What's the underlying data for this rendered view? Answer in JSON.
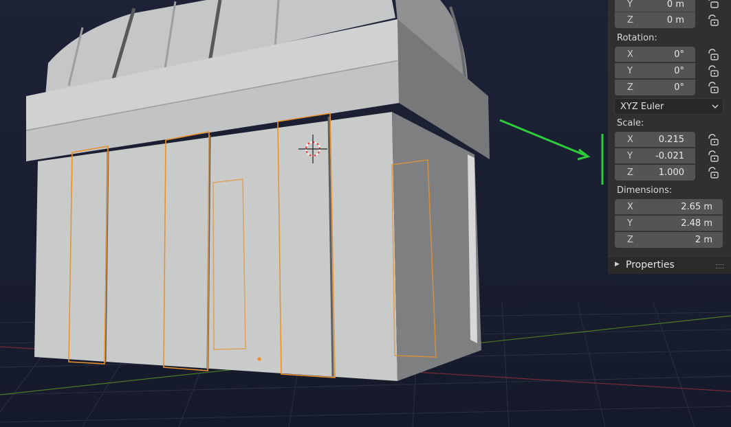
{
  "panel": {
    "location": {
      "y": {
        "axis": "Y",
        "value": "0 m"
      },
      "z": {
        "axis": "Z",
        "value": "0 m"
      }
    },
    "rotation": {
      "label": "Rotation:",
      "x": {
        "axis": "X",
        "value": "0°"
      },
      "y": {
        "axis": "Y",
        "value": "0°"
      },
      "z": {
        "axis": "Z",
        "value": "0°"
      }
    },
    "rotation_mode": "XYZ Euler",
    "scale": {
      "label": "Scale:",
      "x": {
        "axis": "X",
        "value": "0.215"
      },
      "y": {
        "axis": "Y",
        "value": "-0.021"
      },
      "z": {
        "axis": "Z",
        "value": "1.000"
      }
    },
    "dimensions": {
      "label": "Dimensions:",
      "x": {
        "axis": "X",
        "value": "2.65 m"
      },
      "y": {
        "axis": "Y",
        "value": "2.48 m"
      },
      "z": {
        "axis": "Z",
        "value": "2 m"
      }
    },
    "properties_label": "Properties"
  },
  "colors": {
    "viewport_bg": "#1a1f33",
    "panel_bg": "#303030",
    "field_bg": "#545454",
    "selection_outline": "#e8922e",
    "annotation_green": "#2ecc3a",
    "grid_x_axis": "#8a2b3a",
    "grid_y_axis": "#5d8a2a"
  },
  "icons": [
    "lock-icon",
    "chevron-down-icon",
    "disclosure-triangle-icon",
    "3d-cursor-icon"
  ]
}
